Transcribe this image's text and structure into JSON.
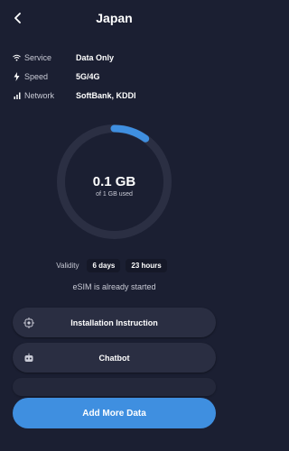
{
  "header": {
    "back_icon": "chevron-left-icon",
    "title": "Japan"
  },
  "info": [
    {
      "icon": "wifi-icon",
      "label": "Service",
      "value": "Data Only"
    },
    {
      "icon": "bolt-icon",
      "label": "Speed",
      "value": "5G/4G"
    },
    {
      "icon": "signal-bars-icon",
      "label": "Network",
      "value": "SoftBank, KDDI"
    }
  ],
  "usage": {
    "used": "0.1 GB",
    "total_text": "of 1 GB used",
    "fraction_used": 0.1
  },
  "validity": {
    "label": "Validity",
    "days": "6 days",
    "hours": "23 hours"
  },
  "status_text": "eSIM is already started",
  "buttons": {
    "install": {
      "label": "Installation Instruction",
      "icon": "install-icon"
    },
    "chatbot": {
      "label": "Chatbot",
      "icon": "chatbot-icon"
    }
  },
  "primary": {
    "label": "Add More Data"
  },
  "colors": {
    "background": "#1b1f32",
    "card": "#2a2e42",
    "accent": "#3f8fe0",
    "ring_track": "#2b2f43"
  }
}
